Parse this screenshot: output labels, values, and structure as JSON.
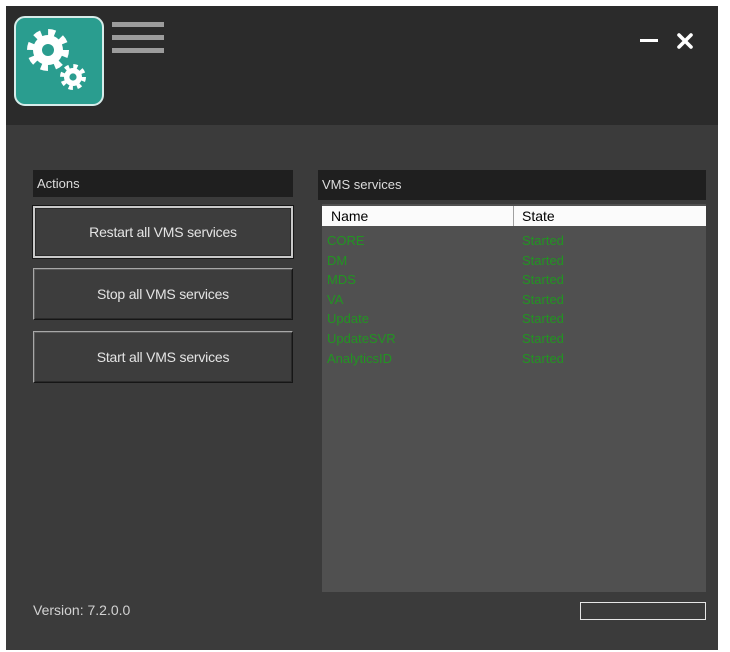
{
  "titlebar": {
    "logo_icon": "gears-icon",
    "menu_icon": "hamburger-menu-icon",
    "minimize_icon": "minimize-icon",
    "close_icon": "close-icon"
  },
  "actions": {
    "title": "Actions",
    "buttons": [
      {
        "label": "Restart all VMS services",
        "focused": true
      },
      {
        "label": "Stop all VMS services",
        "focused": false
      },
      {
        "label": "Start all VMS services",
        "focused": false
      }
    ]
  },
  "services": {
    "title": "VMS services",
    "columns": [
      "Name",
      "State"
    ],
    "rows": [
      {
        "name": "CORE",
        "state": "Started"
      },
      {
        "name": "DM",
        "state": "Started"
      },
      {
        "name": "MDS",
        "state": "Started"
      },
      {
        "name": "VA",
        "state": "Started"
      },
      {
        "name": "Update",
        "state": "Started"
      },
      {
        "name": "UpdateSVR",
        "state": "Started"
      },
      {
        "name": "AnalyticsID",
        "state": "Started"
      }
    ]
  },
  "footer": {
    "version": "Version: 7.2.0.0",
    "progress": 0
  },
  "colors": {
    "window_bg": "#3b3b3b",
    "titlebar_bg": "#2b2b2b",
    "accent": "#2a9d8f",
    "section_bg": "#1f1f1f",
    "list_bg": "#505050",
    "service_text": "#229422",
    "text": "#dcdcdc"
  }
}
